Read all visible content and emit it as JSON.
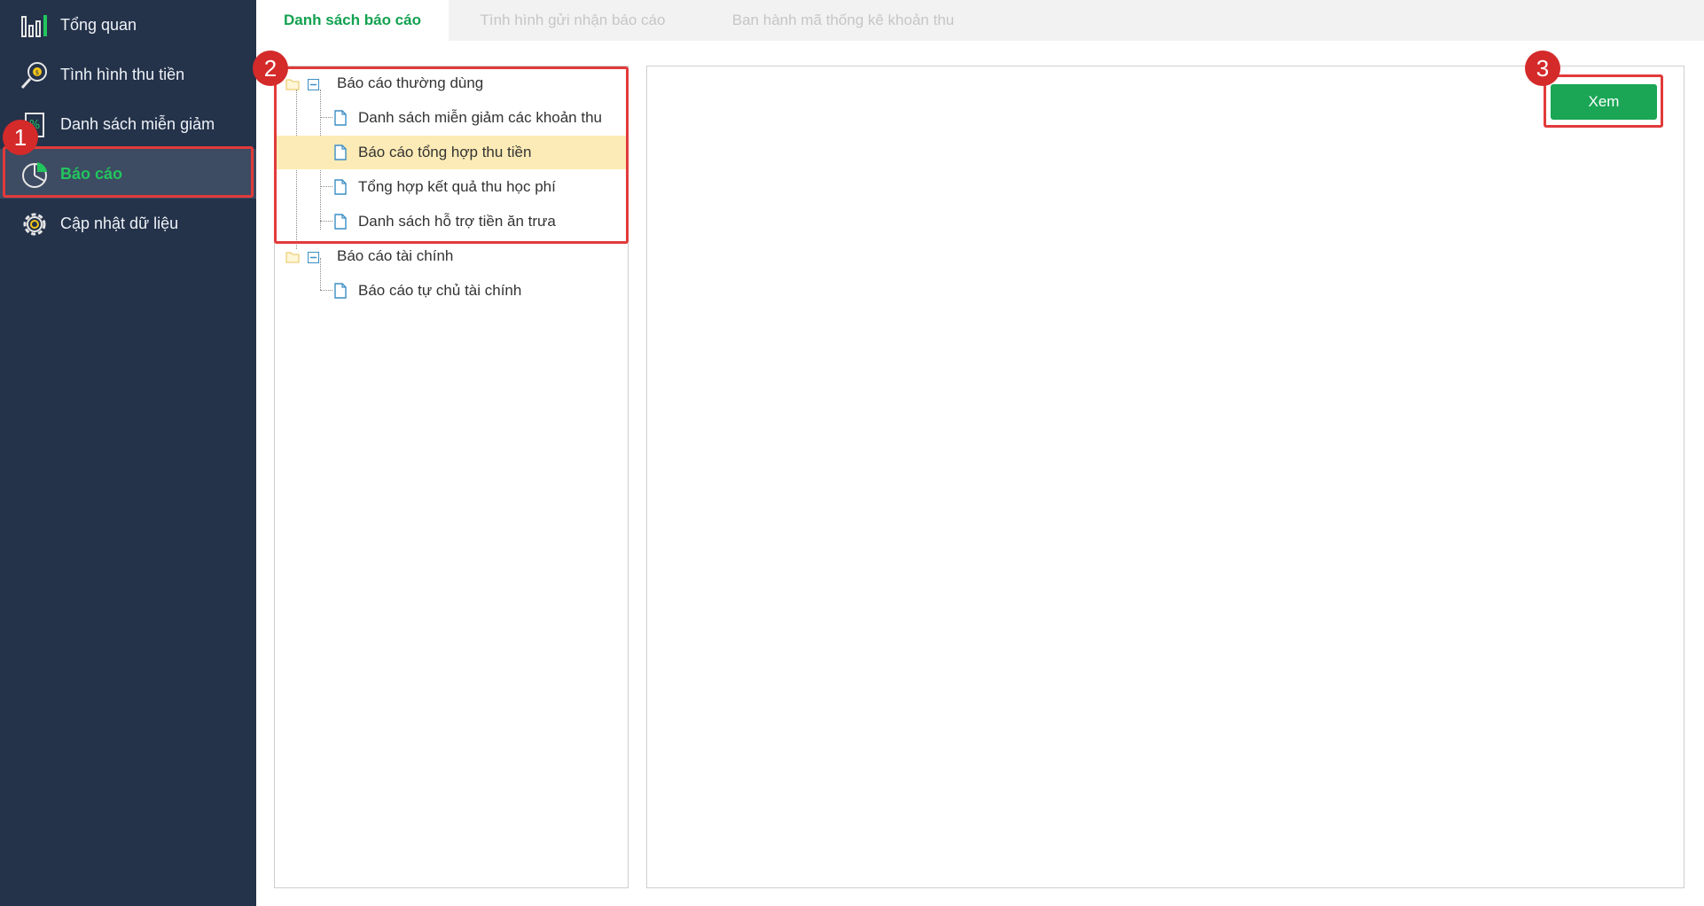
{
  "sidebar": {
    "items": [
      {
        "label": "Tổng quan",
        "icon": "bar-chart-icon"
      },
      {
        "label": "Tình hình thu tiền",
        "icon": "money-search-icon"
      },
      {
        "label": "Danh sách miễn giảm",
        "icon": "percent-document-icon"
      },
      {
        "label": "Báo cáo",
        "icon": "pie-chart-icon",
        "active": true
      },
      {
        "label": "Cập nhật dữ liệu",
        "icon": "gear-icon"
      }
    ]
  },
  "tabs": [
    {
      "label": "Danh sách báo cáo",
      "active": true
    },
    {
      "label": "Tình hình gửi nhận báo cáo"
    },
    {
      "label": "Ban hành mã thống kê khoản thu"
    }
  ],
  "tree": {
    "groups": [
      {
        "label": "Báo cáo thường dùng",
        "children": [
          "Danh sách miễn giảm các khoản thu",
          "Báo cáo tổng hợp thu tiền",
          "Tổng hợp kết quả thu học phí",
          "Danh sách hỗ trợ tiền ăn trưa"
        ]
      },
      {
        "label": "Báo cáo tài chính",
        "children": [
          "Báo cáo tự chủ tài chính"
        ]
      }
    ],
    "selected": "Báo cáo tổng hợp thu tiền"
  },
  "actions": {
    "view_label": "Xem"
  },
  "annotations": [
    "1",
    "2",
    "3"
  ],
  "colors": {
    "sidebar_bg": "#24324a",
    "active_green": "#22c55e",
    "button_green": "#1aa655",
    "annotation_red": "#e23a3a",
    "selected_row": "#fcebb6"
  }
}
